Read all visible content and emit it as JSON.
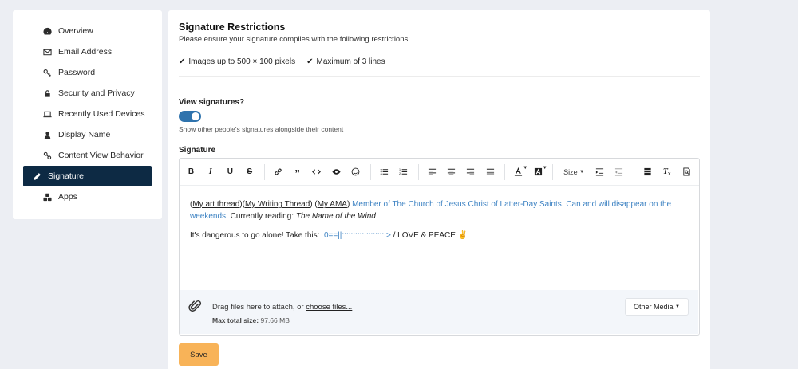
{
  "sidebar": {
    "items": [
      {
        "label": "Overview",
        "icon": "dashboard-icon"
      },
      {
        "label": "Email Address",
        "icon": "envelope-icon"
      },
      {
        "label": "Password",
        "icon": "key-icon"
      },
      {
        "label": "Security and Privacy",
        "icon": "lock-icon"
      },
      {
        "label": "Recently Used Devices",
        "icon": "laptop-icon"
      },
      {
        "label": "Display Name",
        "icon": "user-icon"
      },
      {
        "label": "Content View Behavior",
        "icon": "link-icon"
      },
      {
        "label": "Signature",
        "icon": "pen-icon",
        "active": true
      },
      {
        "label": "Apps",
        "icon": "cubes-icon"
      }
    ]
  },
  "restrictions": {
    "title": "Signature Restrictions",
    "subtitle": "Please ensure your signature complies with the following restrictions:",
    "items": [
      "Images up to 500 × 100 pixels",
      "Maximum of 3 lines"
    ]
  },
  "view_signatures": {
    "label": "View signatures?",
    "enabled": true,
    "help": "Show other people's signatures alongside their content"
  },
  "signature": {
    "label": "Signature",
    "toolbar_size_label": "Size",
    "line1": {
      "link1": "My art thread",
      "link2": "My Writing Thread",
      "link3": "My AMA",
      "blue_text": "Member of The Church of Jesus Christ of Latter-Day Saints. Can and will disappear on the weekends.",
      "plain_text": "Currently reading:",
      "italic_text": "The Name of the Wind"
    },
    "line2": {
      "text": "It's dangerous to go alone! Take this:",
      "ascii": "0==||::::::::::::::::::::>",
      "tail": "/ LOVE & PEACE",
      "emoji": "✌"
    }
  },
  "attachments": {
    "drag_text": "Drag files here to attach, or",
    "choose_link": "choose files...",
    "max_label": "Max total size:",
    "max_value": "97.66 MB",
    "other_media": "Other Media"
  },
  "save_label": "Save",
  "colors": {
    "accent": "#0d2a44",
    "toggle": "#2f73ad",
    "link_blue": "#3e83c3",
    "save": "#f8b358"
  }
}
